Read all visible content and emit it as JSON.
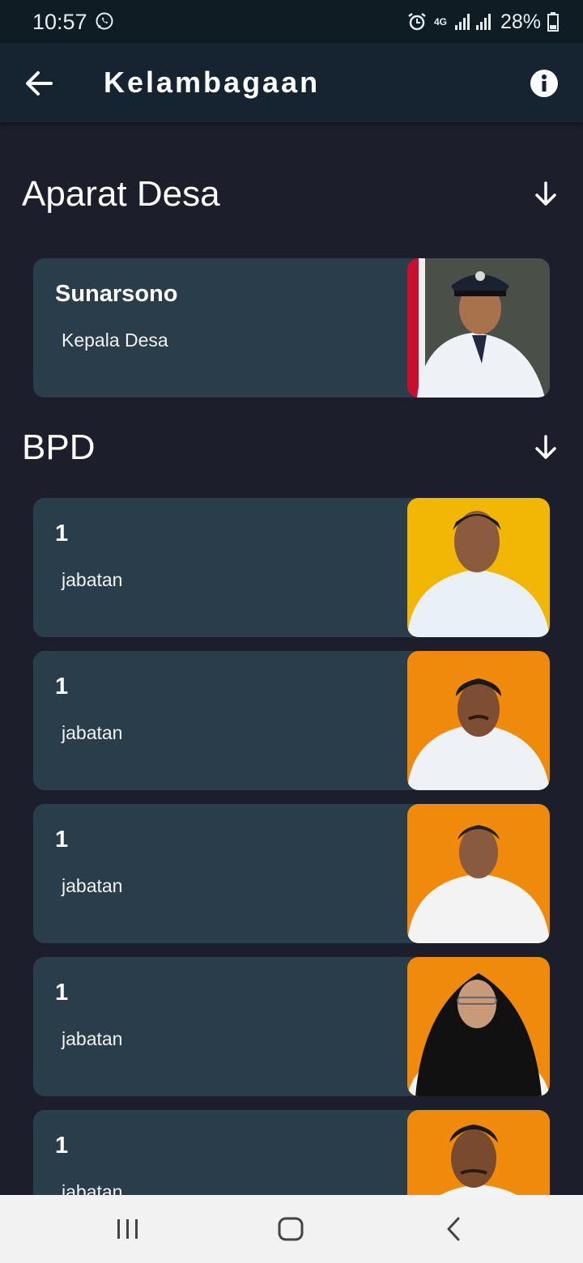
{
  "status_bar": {
    "time": "10:57",
    "network": "4G",
    "battery": "28%",
    "icons": [
      "whatsapp-icon",
      "alarm-icon",
      "signal-icon",
      "battery-icon"
    ]
  },
  "app_bar": {
    "title": "Kelambagaan",
    "back_icon": "arrow-left-icon",
    "info_icon": "info-icon"
  },
  "sections": [
    {
      "title": "Aparat Desa",
      "toggle_icon": "arrow-down-icon",
      "items": [
        {
          "name": "Sunarsono",
          "role": "Kepala Desa",
          "photo_bg": "#4a4f48"
        }
      ]
    },
    {
      "title": "BPD",
      "toggle_icon": "arrow-down-icon",
      "items": [
        {
          "name": "1",
          "role": "jabatan",
          "photo_bg": "#f2b705"
        },
        {
          "name": "1",
          "role": "jabatan",
          "photo_bg": "#f08a0c"
        },
        {
          "name": "1",
          "role": "jabatan",
          "photo_bg": "#f08a0c"
        },
        {
          "name": "1",
          "role": "jabatan",
          "photo_bg": "#f08a0c"
        },
        {
          "name": "1",
          "role": "jabatan",
          "photo_bg": "#f08a0c"
        }
      ]
    }
  ],
  "nav_bar": {
    "icons": [
      "recent-apps-icon",
      "home-icon",
      "back-nav-icon"
    ]
  },
  "colors": {
    "background": "#1c1f2b",
    "app_bar": "#152430",
    "card": "#293d4a"
  }
}
